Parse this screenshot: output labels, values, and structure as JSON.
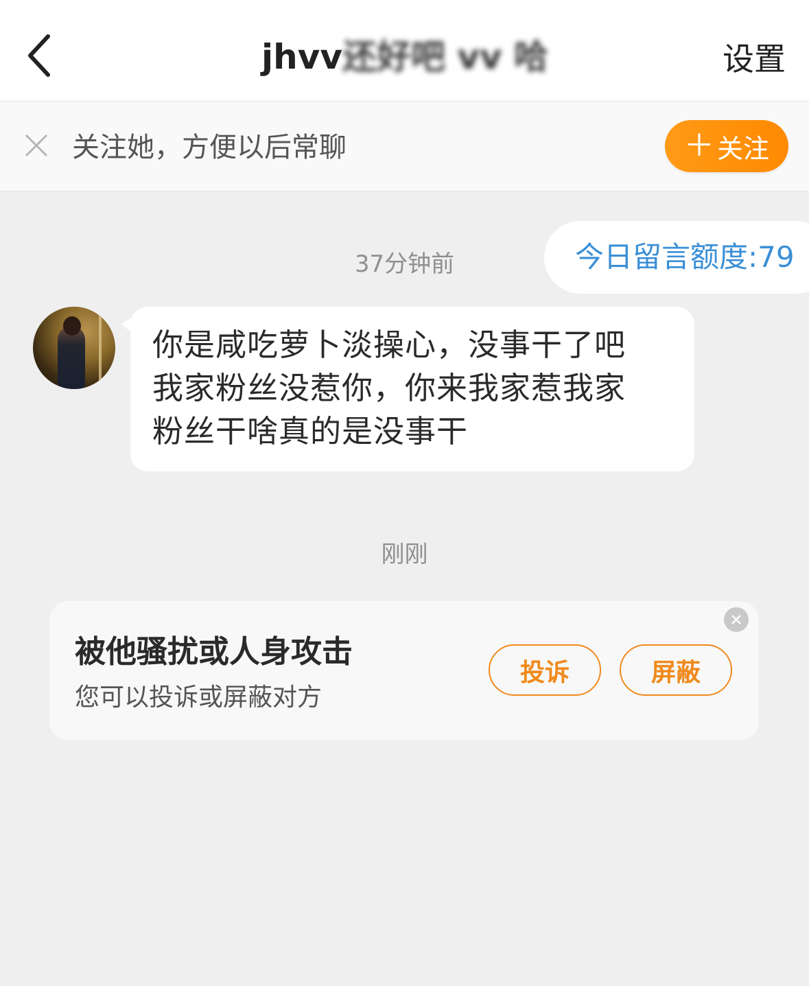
{
  "header": {
    "title_visible": "jhvv",
    "title_obscured": "还好吧 vv 哈",
    "settings_label": "设置",
    "back_icon": "chevron-left-icon"
  },
  "follow_bar": {
    "close_icon": "close-icon",
    "prompt": "关注她，方便以后常聊",
    "follow_button_plus": "＋",
    "follow_button_label": "关注",
    "button_color": "#ff8f0d"
  },
  "quota": {
    "text": "今日留言额度:79",
    "color": "#3b8fd6"
  },
  "messages": [
    {
      "timestamp": "37分钟前",
      "lines": [
        "你是咸吃萝卜淡操心，没事干了吧",
        "我家粉丝没惹你，你来我家惹我家",
        "粉丝干啥真的是没事干"
      ]
    }
  ],
  "second_timestamp": "刚刚",
  "report_card": {
    "title": "被他骚扰或人身攻击",
    "subtitle": "您可以投诉或屏蔽对方",
    "complain_label": "投诉",
    "block_label": "屏蔽",
    "close_icon": "close-circle-icon",
    "accent_color": "#f08a1c"
  }
}
